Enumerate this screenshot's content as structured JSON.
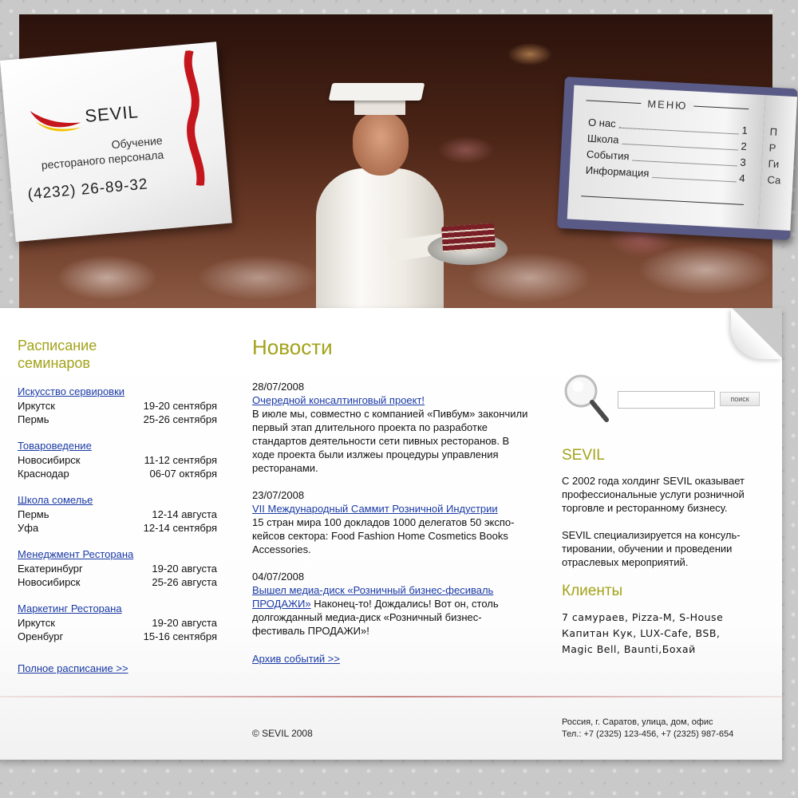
{
  "brand": {
    "logo_text": "SEVIL",
    "tagline_line1": "Обучение",
    "tagline_line2": "ресторaного персонала",
    "phone": "(4232) 26-89-32",
    "colors": {
      "accent_green": "#a3a21a",
      "link_blue": "#1a3aa6",
      "ribbon_red": "#c4161c",
      "logo_yellow": "#f2c200"
    }
  },
  "menu": {
    "title": "МЕНЮ",
    "items": [
      {
        "label": "О нас",
        "num": "1"
      },
      {
        "label": "Школа",
        "num": "2"
      },
      {
        "label": "События",
        "num": "3"
      },
      {
        "label": "Информация",
        "num": "4"
      }
    ],
    "right_page_fragments": [
      "П",
      "Р",
      "Ги",
      "Са"
    ]
  },
  "schedule": {
    "title_line1": "Расписание",
    "title_line2": "семинаров",
    "groups": [
      {
        "title": "Искусство сервировки",
        "rows": [
          {
            "city": "Иркутск",
            "dates": "19-20 сентября"
          },
          {
            "city": "Пермь",
            "dates": "25-26 сентября"
          }
        ]
      },
      {
        "title": "Товароведение",
        "rows": [
          {
            "city": "Новосибирск",
            "dates": "11-12 сентября"
          },
          {
            "city": "Краснодар",
            "dates": "06-07 октября"
          }
        ]
      },
      {
        "title": "Школа сомелье",
        "rows": [
          {
            "city": "Пермь",
            "dates": "12-14 августа"
          },
          {
            "city": "Уфа",
            "dates": "12-14 сентября"
          }
        ]
      },
      {
        "title": "Менеджмент Ресторана",
        "rows": [
          {
            "city": "Екатеринбург",
            "dates": "19-20 августа"
          },
          {
            "city": "Новосибирск",
            "dates": "25-26 августа"
          }
        ]
      },
      {
        "title": "Маркетинг Ресторана",
        "rows": [
          {
            "city": "Иркутск",
            "dates": "19-20 августа"
          },
          {
            "city": "Оренбург",
            "dates": "15-16 сентября"
          }
        ]
      }
    ],
    "full_link": "Полное расписание >>"
  },
  "news": {
    "title": "Новости",
    "items": [
      {
        "date": "28/07/2008",
        "headline": "Очередной консалтинговый проект!",
        "lead": "",
        "body": "В июле мы, совместно с компанией «Пивбум» закончили первый этап длительного проекта по разработке стандартов деятельности сети пивных ресторанов. В ходе проекта были излжеы процедуры управления ресторанами."
      },
      {
        "date": "23/07/2008",
        "headline": "VII Международный Саммит Розничной Индустрии",
        "lead": "",
        "body": "15 стран мира 100 докладов 1000 делегатов 50 экспо-кейсов сектора: Food Fashion Home Cosmetics Books Accessories."
      },
      {
        "date": "04/07/2008",
        "headline": "Вышел медиа-диск «Розничный бизнес-фесиваль ПРОДАЖИ»",
        "lead": "",
        "body": " Наконец-то! Дождались! Вот он, столь долгожданный медиа-диск «Розничный бизнес-фестиваль ПРОДАЖИ»!"
      }
    ],
    "archive_link": "Архив событий >>"
  },
  "search": {
    "placeholder": "",
    "value": "",
    "button_label": "поиск"
  },
  "about": {
    "title": "SEVIL",
    "para1": "С 2002 года холдинг SEVIL оказывает профессиональные услуги розничной торговле и ресторанному бизнесу.",
    "para2": "SEVIL специализируется на консуль-тировании, обучении и проведении отраслевых мероприятий."
  },
  "clients": {
    "title": "Клиенты",
    "lines": [
      "7 самураев, Pizza-M, S-House",
      "Капитан Кук, LUX-Cafe, BSB,",
      "Magic Bell, Baunti,Бохай"
    ]
  },
  "footer": {
    "copyright": "© SEVIL 2008",
    "address_line1": "Россия, г. Саратов, улица, дом, офис",
    "address_line2": "Тел.: +7 (2325) 123-456, +7 (2325) 987-654"
  },
  "icons": [
    "logo-mark-icon",
    "ribbon-icon",
    "magnifier-icon"
  ]
}
